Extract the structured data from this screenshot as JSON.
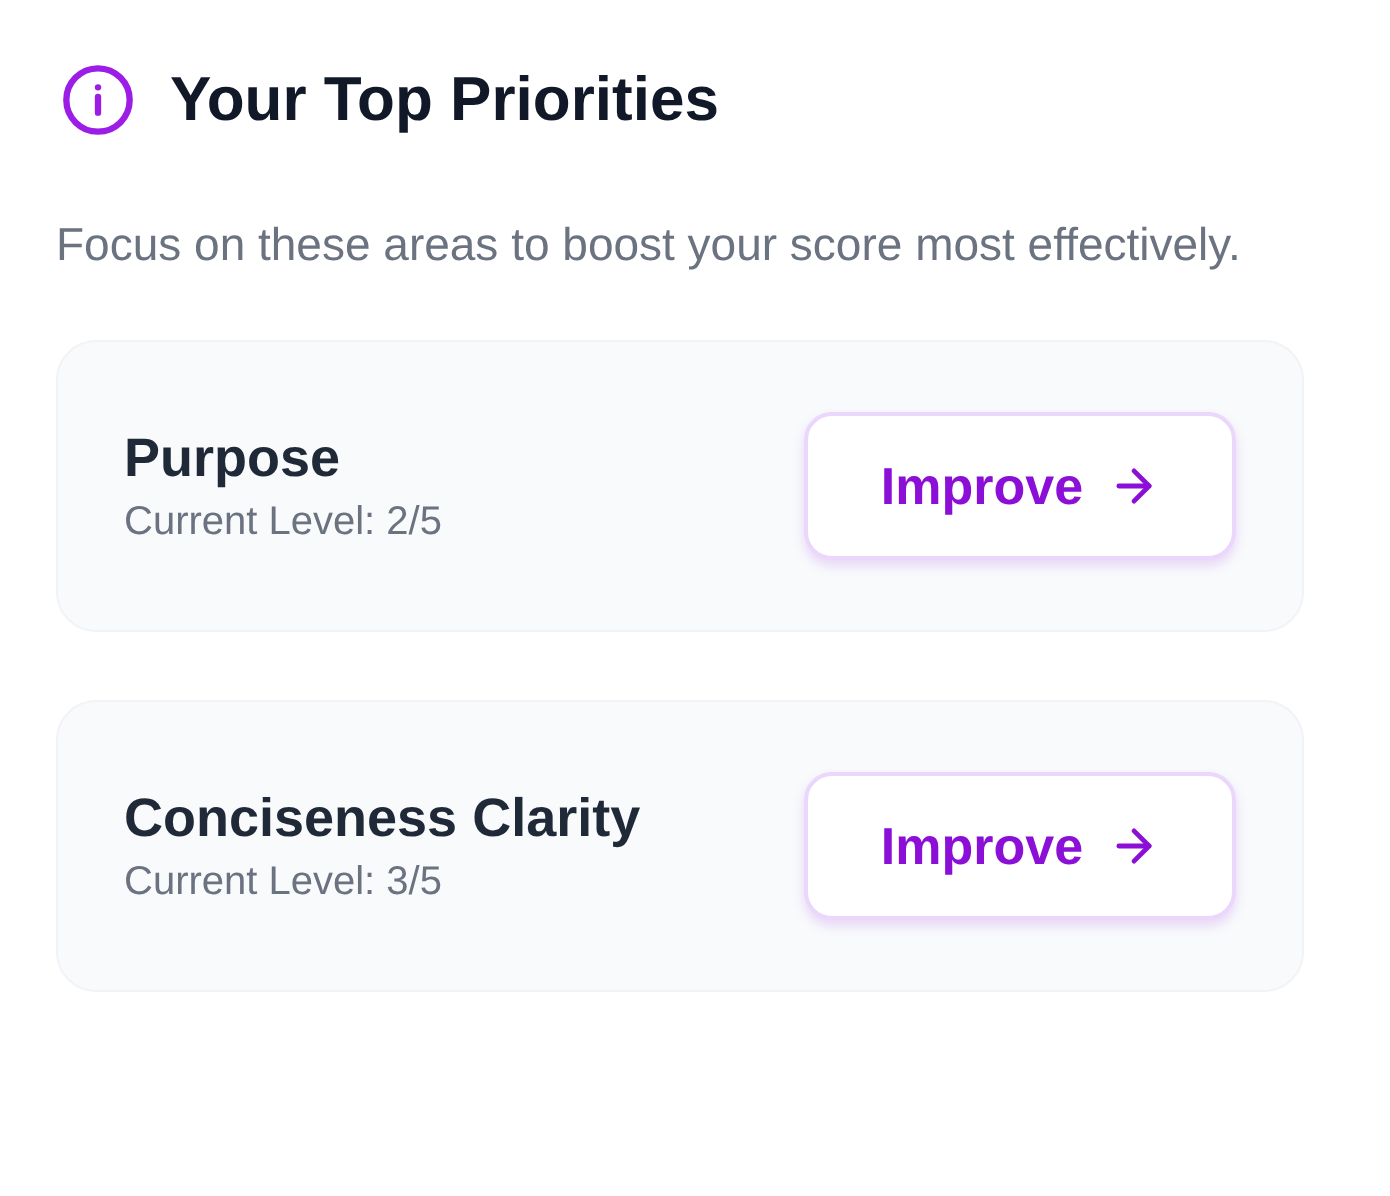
{
  "header": {
    "title": "Your Top Priorities"
  },
  "description": "Focus on these areas to boost your score most effectively.",
  "priorities": [
    {
      "name": "Purpose",
      "level_text": "Current Level: 2/5",
      "action": "Improve"
    },
    {
      "name": "Conciseness Clarity",
      "level_text": "Current Level: 3/5",
      "action": "Improve"
    }
  ]
}
